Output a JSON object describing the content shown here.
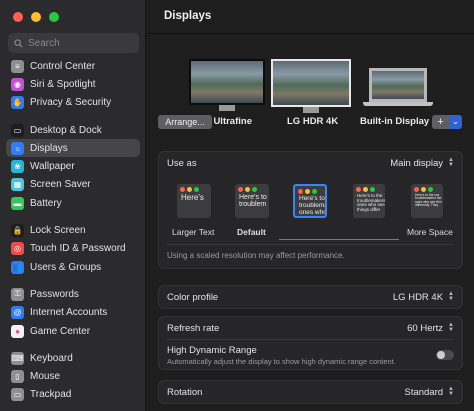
{
  "window": {
    "traffic_colors": [
      "#fe5f57",
      "#febc2e",
      "#28c840"
    ]
  },
  "search": {
    "placeholder": "Search"
  },
  "sidebar": {
    "items": [
      {
        "label": "Control Center",
        "icon": "control-center-icon",
        "color": "#8e8e93",
        "glyph": "≡"
      },
      {
        "label": "Siri & Spotlight",
        "icon": "siri-icon",
        "color": "#c34fd6",
        "glyph": "◉"
      },
      {
        "label": "Privacy & Security",
        "icon": "hand-icon",
        "color": "#2f7cf6",
        "glyph": "✋"
      },
      {
        "label": "Desktop & Dock",
        "icon": "dock-icon",
        "color": "#1d1d1f",
        "glyph": "▭"
      },
      {
        "label": "Displays",
        "icon": "sun-icon",
        "color": "#2f7cf6",
        "glyph": "☼"
      },
      {
        "label": "Wallpaper",
        "icon": "wallpaper-icon",
        "color": "#26b5d9",
        "glyph": "❀"
      },
      {
        "label": "Screen Saver",
        "icon": "screen-saver-icon",
        "color": "#4cc4d8",
        "glyph": "▦"
      },
      {
        "label": "Battery",
        "icon": "battery-icon",
        "color": "#34c759",
        "glyph": "▬"
      },
      {
        "label": "Lock Screen",
        "icon": "lock-icon",
        "color": "#1d1d1f",
        "glyph": "🔒"
      },
      {
        "label": "Touch ID & Password",
        "icon": "fingerprint-icon",
        "color": "#ef4b4b",
        "glyph": "◎"
      },
      {
        "label": "Users & Groups",
        "icon": "users-icon",
        "color": "#2f7cf6",
        "glyph": "👥"
      },
      {
        "label": "Passwords",
        "icon": "key-icon",
        "color": "#8e8e93",
        "glyph": "⚿"
      },
      {
        "label": "Internet Accounts",
        "icon": "at-icon",
        "color": "#2f7cf6",
        "glyph": "@"
      },
      {
        "label": "Game Center",
        "icon": "game-center-icon",
        "color": "#f2f2f2",
        "glyph": "●"
      },
      {
        "label": "Keyboard",
        "icon": "keyboard-icon",
        "color": "#8e8e93",
        "glyph": "⌨"
      },
      {
        "label": "Mouse",
        "icon": "mouse-icon",
        "color": "#8e8e93",
        "glyph": "▯"
      },
      {
        "label": "Trackpad",
        "icon": "trackpad-icon",
        "color": "#8e8e93",
        "glyph": "▭"
      }
    ],
    "selected": "Displays"
  },
  "main": {
    "title": "Displays",
    "monitors": [
      {
        "label": "g Ultrafine"
      },
      {
        "label": "LG HDR 4K"
      },
      {
        "label": "Built-in Display"
      }
    ],
    "arrange_label": "Arrange...",
    "plus_label": "+",
    "use_as": {
      "label": "Use as",
      "value": "Main display"
    },
    "resolutions": [
      {
        "text": "Here's",
        "label": "Larger Text"
      },
      {
        "text": "Here's to\ntroublem",
        "label": "Default"
      },
      {
        "text": "Here's to t\ntroublema\nones who",
        "label": ""
      },
      {
        "text": "Here's to the\ntroublemakers\nones who see\nthings differ",
        "label": ""
      },
      {
        "text": "Here's to the cra\ntroublemakers the\nones who see thin\ndifferently. They",
        "label": "More Space"
      }
    ],
    "scaled_note": "Using a scaled resolution may affect performance.",
    "color_profile": {
      "label": "Color profile",
      "value": "LG HDR 4K"
    },
    "refresh_rate": {
      "label": "Refresh rate",
      "value": "60 Hertz"
    },
    "hdr": {
      "label": "High Dynamic Range",
      "description": "Automatically adjust the display to show high dynamic range content.",
      "on": false
    },
    "rotation": {
      "label": "Rotation",
      "value": "Standard"
    }
  }
}
